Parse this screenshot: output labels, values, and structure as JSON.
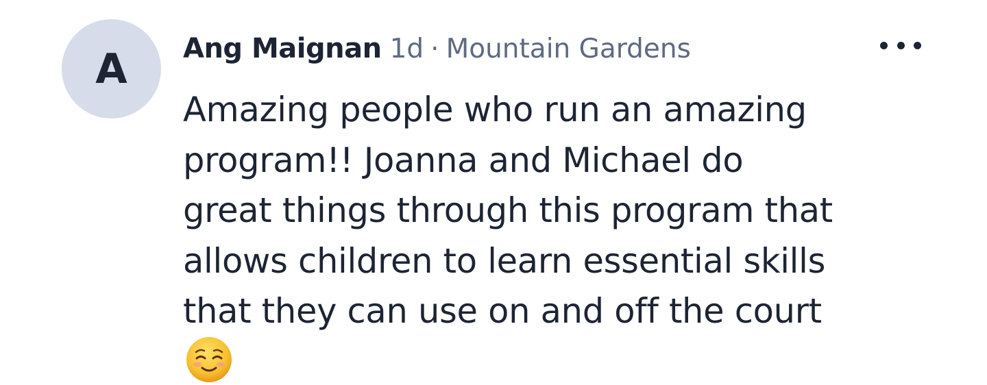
{
  "comment": {
    "avatar_initial": "A",
    "author": "Ang Maignan",
    "time": "1d",
    "separator": "·",
    "location": "Mountain Gardens",
    "body_lines": [
      "Amazing people who run an amazing",
      "program!! Joanna and Michael do",
      "great things through this program that",
      "allows children to learn essential skills",
      "that they can use on and off the court"
    ],
    "emoji": "smiling-face-with-smiling-eyes",
    "more_icon": "more-horizontal-icon"
  },
  "colors": {
    "text": "#1d2433",
    "meta": "#5e6a82",
    "avatar_bg": "#d6dcea",
    "emoji_face": "#f7c02f"
  }
}
